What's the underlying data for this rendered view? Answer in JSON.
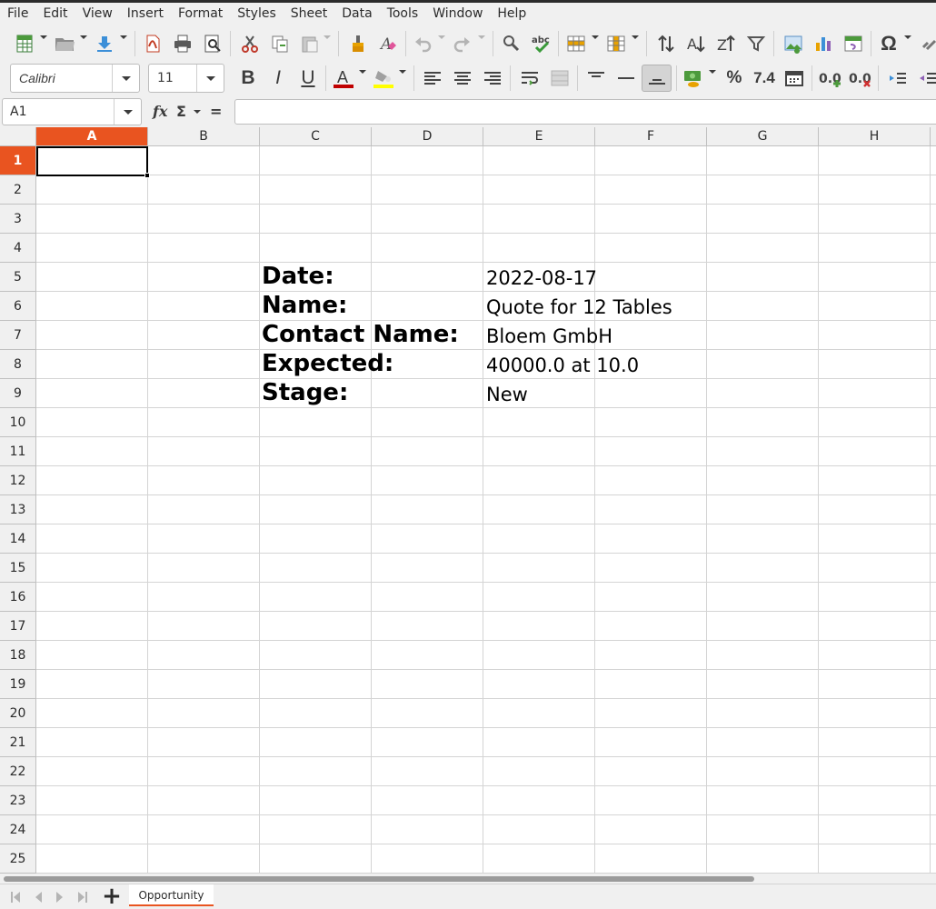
{
  "menu": [
    "File",
    "Edit",
    "View",
    "Insert",
    "Format",
    "Styles",
    "Sheet",
    "Data",
    "Tools",
    "Window",
    "Help"
  ],
  "formatting": {
    "font_name": "Calibri",
    "font_size": "11",
    "bold_glyph": "B",
    "italic_glyph": "I",
    "underline_glyph": "U",
    "percent_glyph": "%",
    "number_glyph": "7.4",
    "font_color": "#c00000",
    "highlight_color": "#ffff00"
  },
  "formula_bar": {
    "cell_reference": "A1",
    "fx_label": "fx",
    "sum_label": "Σ",
    "equals_label": "=",
    "formula": ""
  },
  "columns": [
    "A",
    "B",
    "C",
    "D",
    "E",
    "F",
    "G",
    "H"
  ],
  "rows": [
    "1",
    "2",
    "3",
    "4",
    "5",
    "6",
    "7",
    "8",
    "9",
    "10",
    "11",
    "12",
    "13",
    "14",
    "15",
    "16",
    "17",
    "18",
    "19",
    "20",
    "21",
    "22",
    "23",
    "24",
    "25"
  ],
  "selected_cell": "A1",
  "cells": {
    "C5": "Date:",
    "E5": "2022-08-17",
    "C6": "Name:",
    "E6": "Quote for 12 Tables",
    "C7": "Contact Name:",
    "E7": "Bloem GmbH",
    "C8": "Expected:",
    "E8": "40000.0 at 10.0",
    "C9": "Stage:",
    "E9": "New"
  },
  "sheet_tabs": [
    "Opportunity"
  ],
  "accent_color": "#e95420"
}
